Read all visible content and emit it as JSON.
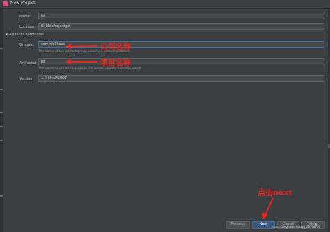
{
  "window": {
    "title": "New Project"
  },
  "form": {
    "name_label": "Name:",
    "name_value": "jsf",
    "location_label": "Location:",
    "location_value": "E:\\IdeaProject\\jsf",
    "artifact_section": "Artifact Coordinates",
    "groupid_label": "GroupId:",
    "groupid_value": "com.nickkaus",
    "groupid_hint": "The name of the artifact group, usually a company domain",
    "artifactid_label": "ArtifactId:",
    "artifactid_value": "jsf",
    "artifactid_hint": "The name of the artifact within the group, usually a project name",
    "version_label": "Version:",
    "version_value": "1.0-SNAPSHOT"
  },
  "annotations": {
    "company_name": "公司名称",
    "project_name": "项目名称",
    "click_next": "点击next"
  },
  "buttons": {
    "previous": "Previous",
    "next": "Next",
    "cancel": "Cancel",
    "help": "Help"
  },
  "watermark": "https://blog.csdn.net/qq_28778760",
  "colors": {
    "background": "#3c3f41",
    "field_background": "#45494a",
    "focus_border": "#3d6ea7",
    "annotation_red": "#e8261f",
    "primary_button": "#365880"
  }
}
